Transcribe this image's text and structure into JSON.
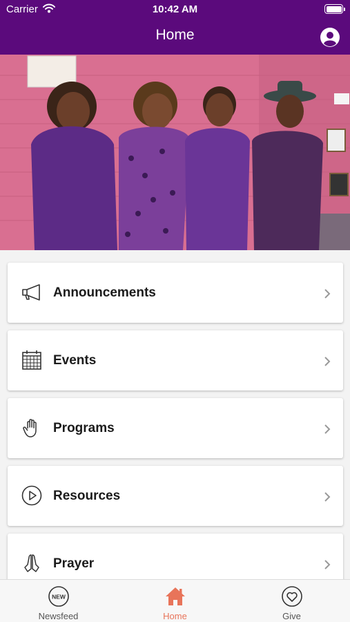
{
  "status_bar": {
    "carrier": "Carrier",
    "time": "10:42 AM"
  },
  "header": {
    "title": "Home"
  },
  "menu": [
    {
      "label": "Announcements",
      "icon": "megaphone-icon"
    },
    {
      "label": "Events",
      "icon": "calendar-icon"
    },
    {
      "label": "Programs",
      "icon": "raised-hand-icon"
    },
    {
      "label": "Resources",
      "icon": "play-circle-icon"
    },
    {
      "label": "Prayer",
      "icon": "praying-hands-icon"
    }
  ],
  "tabs": [
    {
      "label": "Newsfeed",
      "icon": "new-badge-icon",
      "icon_text": "NEW",
      "active": false
    },
    {
      "label": "Home",
      "icon": "home-icon",
      "active": true
    },
    {
      "label": "Give",
      "icon": "heart-icon",
      "active": false
    }
  ],
  "colors": {
    "header": "#5b0a7c",
    "active_tab": "#e8745a",
    "background": "#f3f3f3"
  }
}
